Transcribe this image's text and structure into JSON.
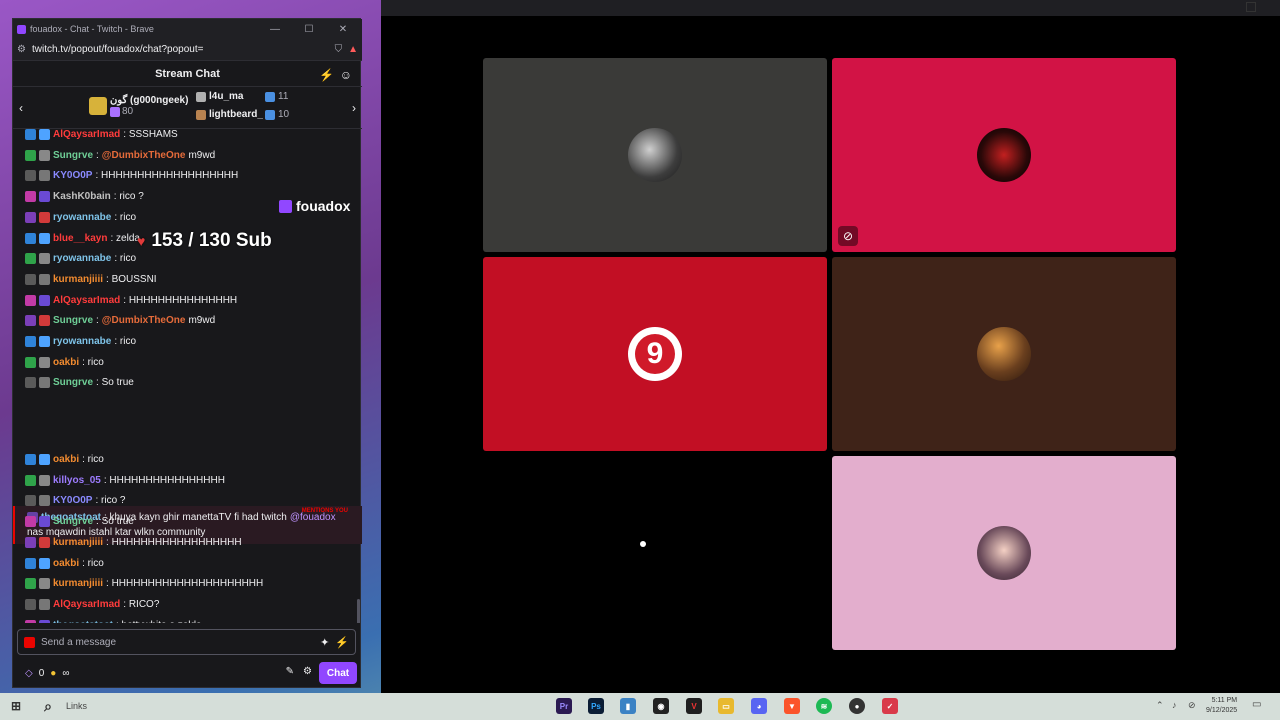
{
  "browser": {
    "tab_title": "fouadox - Chat - Twitch - Brave",
    "url": "twitch.tv/popout/fouadox/chat?popout="
  },
  "chat": {
    "header_title": "Stream Chat",
    "leaderboard": [
      {
        "name": "گون (g000ngeek)",
        "count": "80"
      },
      {
        "name": "l4u_ma",
        "count": "11"
      },
      {
        "name": "lightbeard_",
        "count": "10"
      }
    ],
    "messages": [
      {
        "user": "AlQaysarImad",
        "text": ": SSSHAMS",
        "color": "#ff3c3c"
      },
      {
        "user": "Sungrve",
        "text": ": ",
        "color": "#6fcf97",
        "mention": "@DumbixTheOne",
        "after": " m9wd"
      },
      {
        "user": "KY0O0P",
        "text": ": HHHHHHHHHHHHHHHHHHH",
        "color": "#8a8aff"
      },
      {
        "user": "KashK0bain",
        "text": ": rico ?",
        "color": "#c0c0c0"
      },
      {
        "user": "ryowannabe",
        "text": ": rico",
        "color": "#7ec3e8"
      },
      {
        "user": "blue__kayn",
        "text": ": zelda",
        "color": "#ff3c3c"
      },
      {
        "user": "ryowannabe",
        "text": ": rico",
        "color": "#7ec3e8"
      },
      {
        "user": "kurmanjiiii",
        "text": ": BOUSSNI",
        "color": "#f28b30"
      },
      {
        "user": "AlQaysarImad",
        "text": ": HHHHHHHHHHHHHHH",
        "color": "#ff3c3c"
      },
      {
        "user": "Sungrve",
        "text": ": ",
        "color": "#6fcf97",
        "mention": "@DumbixTheOne",
        "after": " m9wd"
      },
      {
        "user": "ryowannabe",
        "text": ": rico",
        "color": "#7ec3e8"
      },
      {
        "user": "oakbi",
        "text": ": rico",
        "color": "#f28b30"
      },
      {
        "user": "Sungrve",
        "text": ": So true",
        "color": "#6fcf97"
      }
    ],
    "mention_label": "MENTIONS YOU",
    "mention_user": "thegoatstoat",
    "mention_text_1": ": khuya kayn ghir manettaTV fi had twitch",
    "mention_handle": "@fouadox",
    "mention_text_2": "nas mqawdin istahl ktar wlkn community",
    "messages2": [
      {
        "user": "oakbi",
        "text": ": rico",
        "color": "#f28b30"
      },
      {
        "user": "killyos_05",
        "text": ": HHHHHHHHHHHHHHHH",
        "color": "#9d7cff"
      },
      {
        "user": "KY0O0P",
        "text": ": rico ?",
        "color": "#8a8aff"
      },
      {
        "user": "Sungrve",
        "text": ": So true",
        "color": "#6fcf97"
      },
      {
        "user": "kurmanjiiii",
        "text": ": HHHHHHHHHHHHHHHHHH",
        "color": "#f28b30"
      },
      {
        "user": "oakbi",
        "text": ": rico",
        "color": "#f28b30"
      },
      {
        "user": "kurmanjiiii",
        "text": ": HHHHHHHHHHHHHHHHHHHHH",
        "color": "#f28b30"
      },
      {
        "user": "AlQaysarImad",
        "text": ": RICO?",
        "color": "#ff3c3c"
      },
      {
        "user": "thegoatstoat",
        "text": ": bettywhite o zelda",
        "color": "#7ec3e8"
      }
    ],
    "input_placeholder": "Send a message",
    "points": "0",
    "infinity": "∞",
    "chat_button": "Chat"
  },
  "overlay": {
    "channel": "fouadox",
    "sub_goal": "153 / 130 Sub"
  },
  "taskbar": {
    "search_label": "Links",
    "clock_time": "5:11 PM",
    "clock_date": "9/12/2025"
  }
}
